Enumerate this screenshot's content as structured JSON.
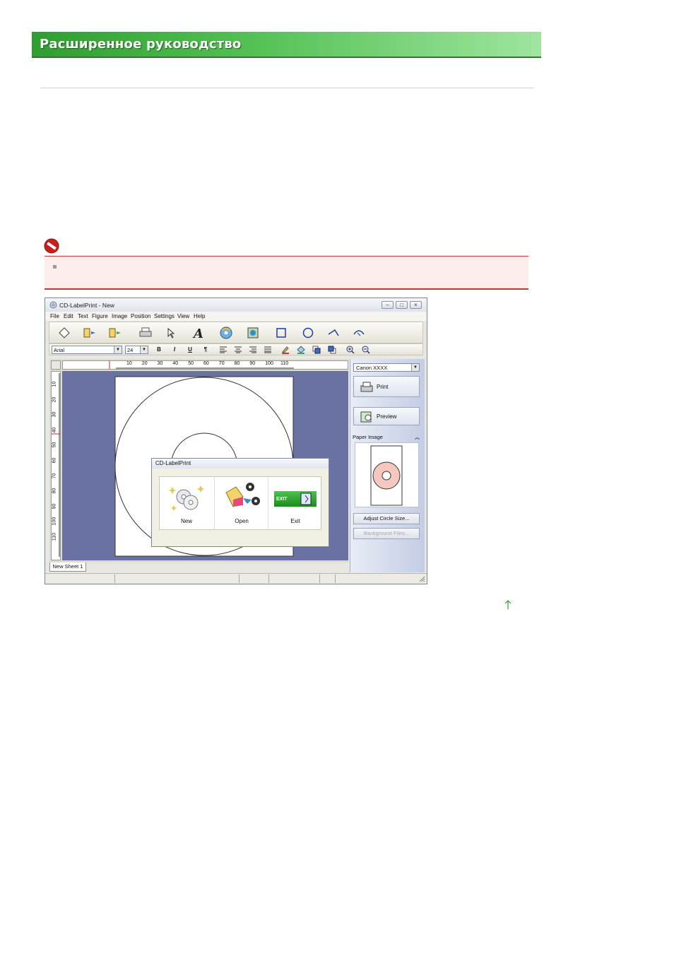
{
  "header": {
    "title": "Расширенное руководство"
  },
  "notice": {
    "text": ""
  },
  "app": {
    "window_title": "CD-LabelPrint - New",
    "menu": [
      "File",
      "Edit",
      "Text",
      "Figure",
      "Image",
      "Position",
      "Settings",
      "View",
      "Help"
    ],
    "font_name": "Arial",
    "font_size": "24",
    "format_buttons": [
      "B",
      "I",
      "U",
      "¶"
    ],
    "ruler_top_labels": [
      "10",
      "20",
      "30",
      "40",
      "50",
      "60",
      "70",
      "80",
      "90",
      "100",
      "110"
    ],
    "ruler_left_labels": [
      "10",
      "20",
      "30",
      "40",
      "50",
      "60",
      "70",
      "80",
      "90",
      "100",
      "110"
    ],
    "sheet_tab": "New Sheet 1",
    "side_panel": {
      "printer": "Canon XXXX",
      "print_label": "Print",
      "preview_label": "Preview",
      "paper_image_label": "Paper Image",
      "adjust_label": "Adjust Circle Size...",
      "background_label": "Background Files..."
    },
    "dialog": {
      "title": "CD-LabelPrint",
      "options": [
        "New",
        "Open",
        "Exit"
      ],
      "exit_badge": "EXIT"
    }
  }
}
